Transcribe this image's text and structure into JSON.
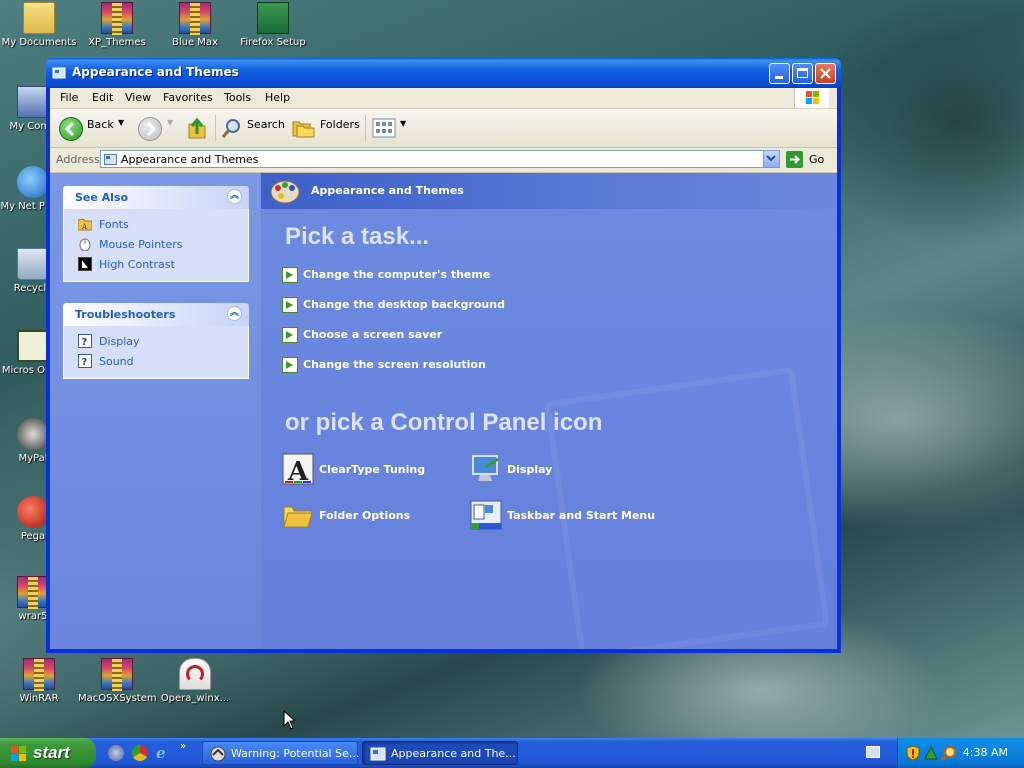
{
  "desktop": {
    "icons": [
      {
        "label": "My Documents"
      },
      {
        "label": "XP_Themes"
      },
      {
        "label": "Blue Max"
      },
      {
        "label": "Firefox Setup"
      },
      {
        "label": "My Comp"
      },
      {
        "label": "My Net Place"
      },
      {
        "label": "Recycle"
      },
      {
        "label": "Micros Outlo"
      },
      {
        "label": "MyPal"
      },
      {
        "label": "Pega"
      },
      {
        "label": "wrar5"
      },
      {
        "label": "WinRAR"
      },
      {
        "label": "MacOSXSystem"
      },
      {
        "label": "Opera_winx..."
      }
    ]
  },
  "window": {
    "title": "Appearance and Themes",
    "menu": [
      "File",
      "Edit",
      "View",
      "Favorites",
      "Tools",
      "Help"
    ],
    "toolbar": {
      "back": "Back",
      "search": "Search",
      "folders": "Folders"
    },
    "address": {
      "label": "Address",
      "value": "Appearance and Themes",
      "go": "Go"
    },
    "see_also": {
      "title": "See Also",
      "items": [
        {
          "label": "Fonts",
          "icon": "folder-fonts-icon"
        },
        {
          "label": "Mouse Pointers",
          "icon": "mouse-icon"
        },
        {
          "label": "High Contrast",
          "icon": "contrast-icon"
        }
      ]
    },
    "troubleshooters": {
      "title": "Troubleshooters",
      "items": [
        {
          "label": "Display",
          "icon": "help-icon"
        },
        {
          "label": "Sound",
          "icon": "help-icon"
        }
      ]
    },
    "content": {
      "header": "Appearance and Themes",
      "pick_task": "Pick a task...",
      "tasks": [
        "Change the computer's theme",
        "Change the desktop background",
        "Choose a screen saver",
        "Change the screen resolution"
      ],
      "pick_icon": "or pick a Control Panel icon",
      "icons": [
        {
          "label": "ClearType Tuning",
          "icon": "cleartype-icon"
        },
        {
          "label": "Display",
          "icon": "display-icon"
        },
        {
          "label": "Folder Options",
          "icon": "folder-options-icon"
        },
        {
          "label": "Taskbar and Start Menu",
          "icon": "taskbar-icon"
        }
      ]
    }
  },
  "taskbar": {
    "start": "start",
    "items": [
      "Warning: Potential Se...",
      "Appearance and The..."
    ],
    "clock": "4:38 AM"
  },
  "colors": {
    "xp_blue": "#0831d9",
    "task_pane": "#6b86dc",
    "link": "#215dc6",
    "start_green": "#3c9b3c"
  }
}
